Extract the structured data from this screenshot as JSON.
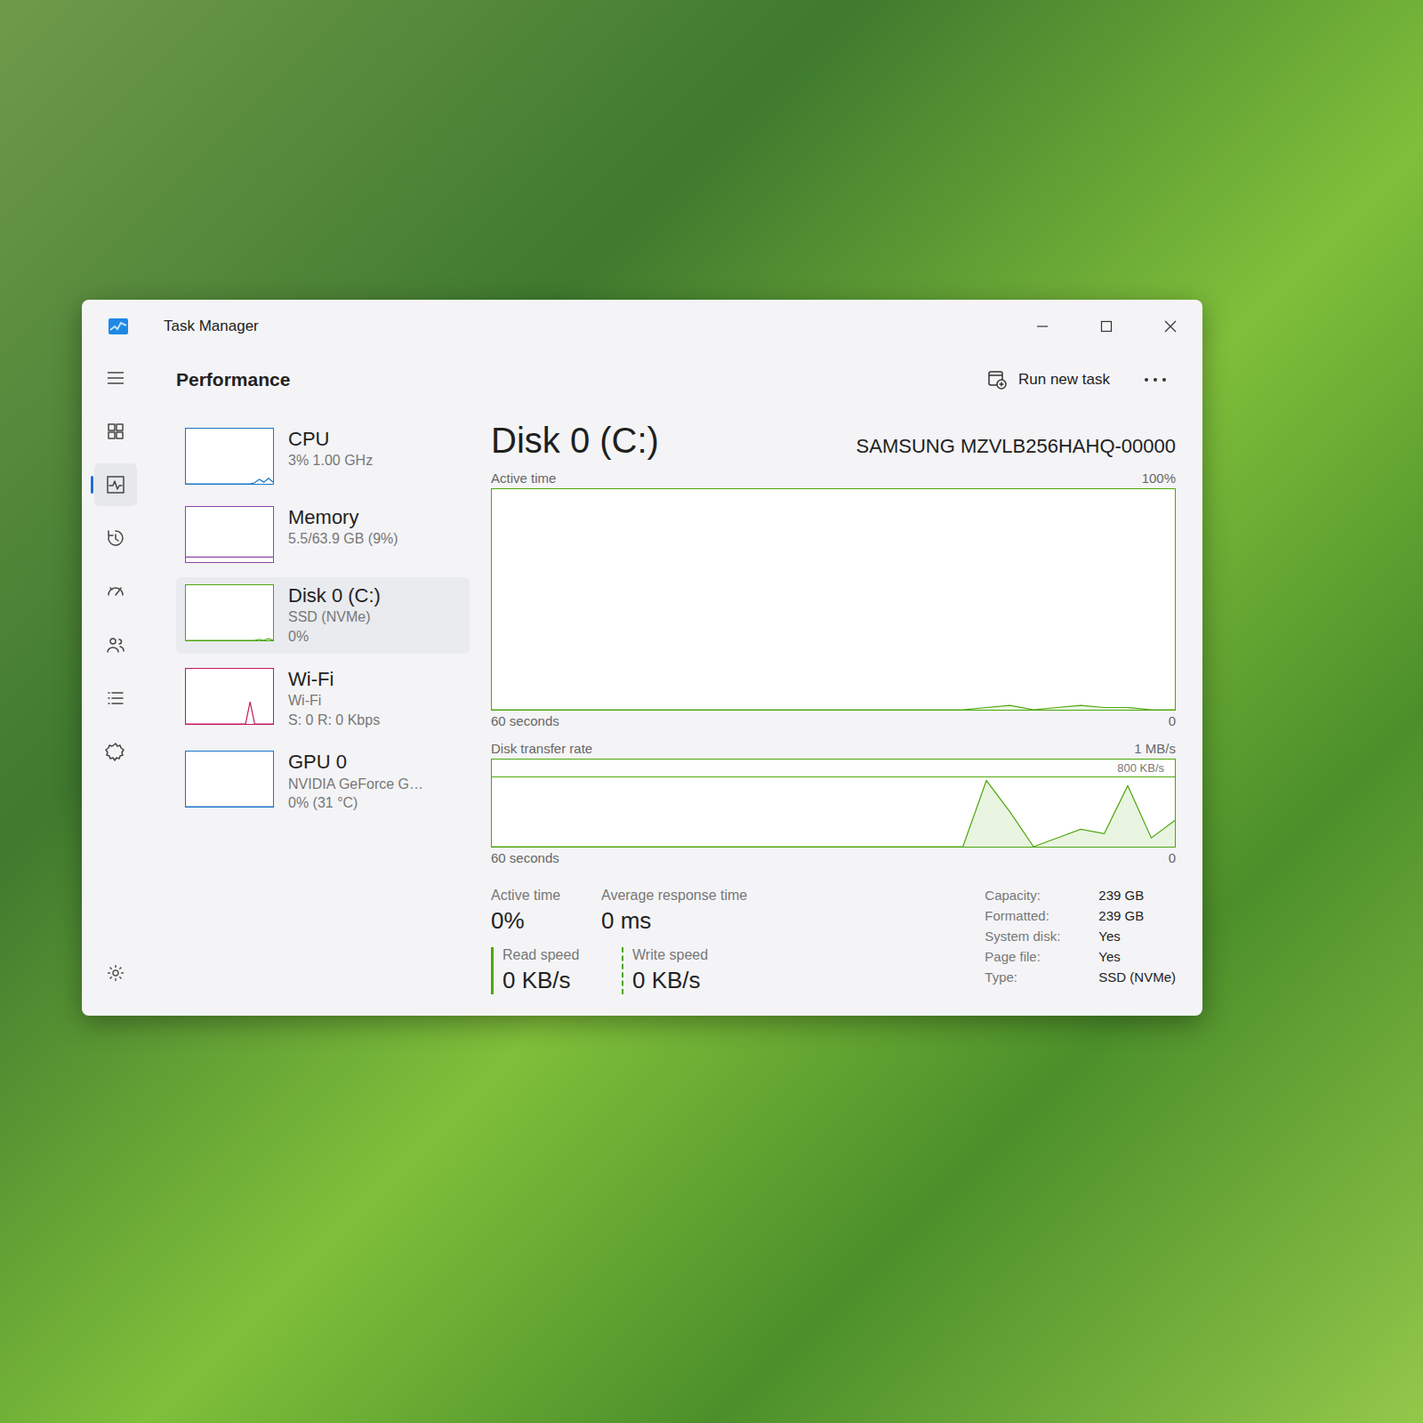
{
  "window": {
    "title": "Task Manager"
  },
  "nav": {
    "items": [
      {
        "selected": false
      },
      {
        "selected": true
      },
      {
        "selected": false
      },
      {
        "selected": false
      },
      {
        "selected": false
      },
      {
        "selected": false
      },
      {
        "selected": false
      }
    ]
  },
  "header": {
    "title": "Performance",
    "run_new_task": "Run new task"
  },
  "devices": [
    {
      "name": "CPU",
      "lines": [
        "3% 1.00 GHz"
      ],
      "selected": false,
      "color": "#1a73c8",
      "history": [
        0,
        0,
        0,
        0,
        0,
        0,
        0,
        0,
        0,
        0,
        0,
        0,
        0,
        0,
        0,
        2,
        8,
        3,
        10,
        3
      ]
    },
    {
      "name": "Memory",
      "lines": [
        "5.5/63.9 GB (9%)"
      ],
      "selected": false,
      "color": "#8e44ad",
      "history": [
        9,
        9,
        9,
        9,
        9,
        9,
        9,
        9,
        9,
        9,
        9,
        9,
        9,
        9,
        9,
        9,
        9,
        9,
        9,
        9
      ]
    },
    {
      "name": "Disk 0 (C:)",
      "lines": [
        "SSD (NVMe)",
        "0%"
      ],
      "selected": true,
      "color": "#4da60c",
      "history": [
        0,
        0,
        0,
        0,
        0,
        0,
        0,
        0,
        0,
        0,
        0,
        0,
        0,
        0,
        0,
        0,
        2,
        0,
        3,
        0
      ]
    },
    {
      "name": "Wi-Fi",
      "lines": [
        "Wi-Fi",
        "S: 0 R: 0 Kbps"
      ],
      "selected": false,
      "color": "#c2185b",
      "history": [
        0,
        0,
        0,
        0,
        0,
        0,
        0,
        0,
        0,
        0,
        0,
        0,
        0,
        0,
        40,
        0,
        0,
        0,
        0,
        0
      ]
    },
    {
      "name": "GPU 0",
      "lines": [
        "NVIDIA GeForce G…",
        "0% (31 °C)"
      ],
      "selected": false,
      "color": "#1a73c8",
      "history": [
        0,
        0,
        0,
        0,
        0,
        0,
        0,
        0,
        0,
        0,
        0,
        0,
        0,
        0,
        0,
        0,
        0,
        0,
        0,
        0
      ]
    }
  ],
  "detail": {
    "title": "Disk 0 (C:)",
    "model": "SAMSUNG MZVLB256HAHQ-00000",
    "charts": [
      {
        "title": "Active time",
        "max_label": "100%",
        "scale_max": 100,
        "span_label": "60 seconds",
        "min_label": "0",
        "gridlines": [],
        "values": [
          0,
          0,
          0,
          0,
          0,
          0,
          0,
          0,
          0,
          0,
          0,
          0,
          0,
          0,
          0,
          0,
          0,
          0,
          0,
          0,
          0,
          1,
          2,
          0,
          1,
          2,
          1,
          1,
          0,
          0
        ]
      },
      {
        "title": "Disk transfer rate",
        "max_label": "1 MB/s",
        "scale_max": 1000,
        "span_label": "60 seconds",
        "min_label": "0",
        "gridlines": [
          {
            "value": 800,
            "label": "800 KB/s"
          }
        ],
        "values": [
          0,
          0,
          0,
          0,
          0,
          0,
          0,
          0,
          0,
          0,
          0,
          0,
          0,
          0,
          0,
          0,
          0,
          0,
          0,
          0,
          0,
          760,
          400,
          0,
          100,
          200,
          150,
          700,
          100,
          300
        ]
      }
    ],
    "stats": [
      {
        "label": "Active time",
        "value": "0%"
      },
      {
        "label": "Average response time",
        "value": "0 ms"
      }
    ],
    "speeds": [
      {
        "label": "Read speed",
        "value": "0 KB/s",
        "kind": "solid"
      },
      {
        "label": "Write speed",
        "value": "0 KB/s",
        "kind": "dashed"
      }
    ],
    "properties": [
      {
        "label": "Capacity:",
        "value": "239 GB"
      },
      {
        "label": "Formatted:",
        "value": "239 GB"
      },
      {
        "label": "System disk:",
        "value": "Yes"
      },
      {
        "label": "Page file:",
        "value": "Yes"
      },
      {
        "label": "Type:",
        "value": "SSD (NVMe)"
      }
    ]
  }
}
